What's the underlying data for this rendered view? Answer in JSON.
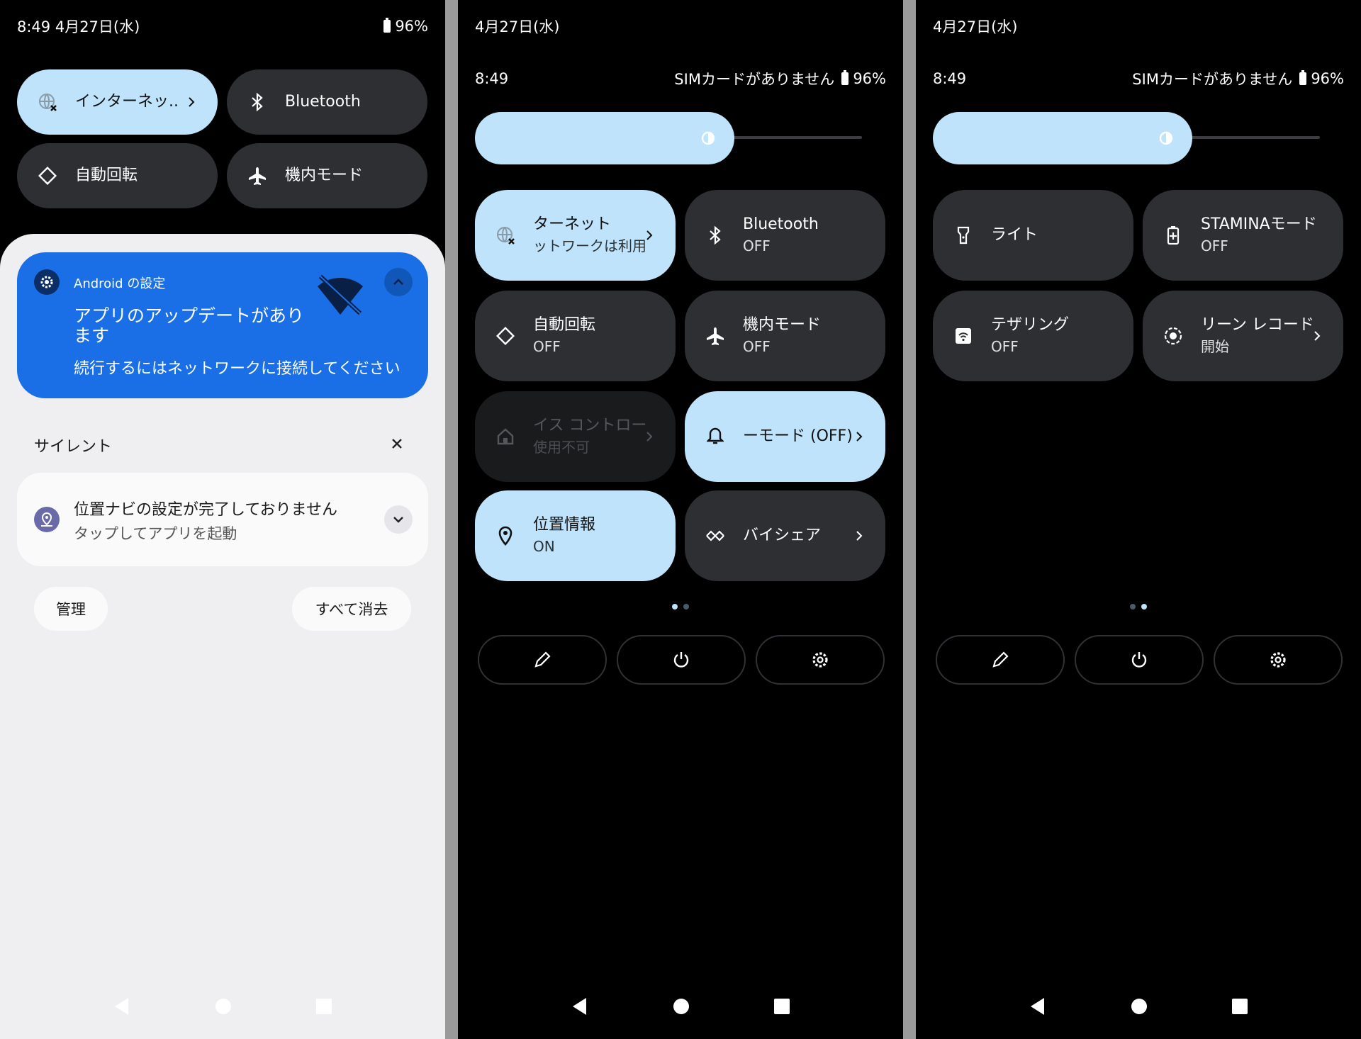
{
  "panel1": {
    "status": {
      "time_date": "8:49 4月27日(水)",
      "battery": "96%"
    },
    "tiles": [
      {
        "label": "インターネッ..",
        "icon": "internet-off-icon",
        "active": true,
        "chevron": true
      },
      {
        "label": "Bluetooth",
        "icon": "bluetooth-icon",
        "active": false
      },
      {
        "label": "自動回転",
        "icon": "auto-rotate-icon",
        "active": false
      },
      {
        "label": "機内モード",
        "icon": "airplane-icon",
        "active": false
      }
    ],
    "notification": {
      "app": "Android の設定",
      "title_line1": "アプリのアップデートがあり",
      "title_line2": "ます",
      "body": "続行するにはネットワークに接続してください"
    },
    "silent_header": "サイレント",
    "silent_notification": {
      "title": "位置ナビの設定が完了しておりません",
      "body": "タップしてアプリを起動"
    },
    "manage_label": "管理",
    "clear_all_label": "すべて消去"
  },
  "panel2": {
    "date": "4月27日(水)",
    "time": "8:49",
    "sim": "SIMカードがありません",
    "battery": "96%",
    "tiles": [
      {
        "t1": "ターネット",
        "t2": "ットワークは利用",
        "icon": "internet-off-icon",
        "style": "light",
        "chevron": true
      },
      {
        "t1": "Bluetooth",
        "t2": "OFF",
        "icon": "bluetooth-icon",
        "style": "dark"
      },
      {
        "t1": "自動回転",
        "t2": "OFF",
        "icon": "auto-rotate-icon",
        "style": "dark"
      },
      {
        "t1": "機内モード",
        "t2": "OFF",
        "icon": "airplane-icon",
        "style": "dark"
      },
      {
        "t1": "イス コントロー",
        "t2": "使用不可",
        "icon": "home-icon",
        "style": "disabled",
        "chevron": true
      },
      {
        "t1": "ーモード (OFF)",
        "t2": "",
        "icon": "bell-icon",
        "style": "light",
        "chevron": true
      },
      {
        "t1": "位置情報",
        "t2": "ON",
        "icon": "location-icon",
        "style": "light"
      },
      {
        "t1": "バイシェア",
        "t2": "",
        "icon": "nearby-share-icon",
        "style": "dark",
        "chevron": true
      }
    ],
    "brightness": 0.67
  },
  "panel3": {
    "date": "4月27日(水)",
    "time": "8:49",
    "sim": "SIMカードがありません",
    "battery": "96%",
    "tiles": [
      {
        "t1": "ライト",
        "t2": "",
        "icon": "flashlight-icon",
        "style": "dark"
      },
      {
        "t1": "STAMINAモード",
        "t2": "OFF",
        "icon": "battery-saver-icon",
        "style": "dark"
      },
      {
        "t1": "テザリング",
        "t2": "OFF",
        "icon": "hotspot-icon",
        "style": "dark"
      },
      {
        "t1": "リーン レコード",
        "t2": "開始",
        "icon": "screen-record-icon",
        "style": "dark",
        "chevron": true
      }
    ],
    "brightness": 0.67
  },
  "colors": {
    "accent_light": "#bfe3fb",
    "tile_dark": "#2d2f33",
    "notif_blue": "#1a6fe6"
  }
}
